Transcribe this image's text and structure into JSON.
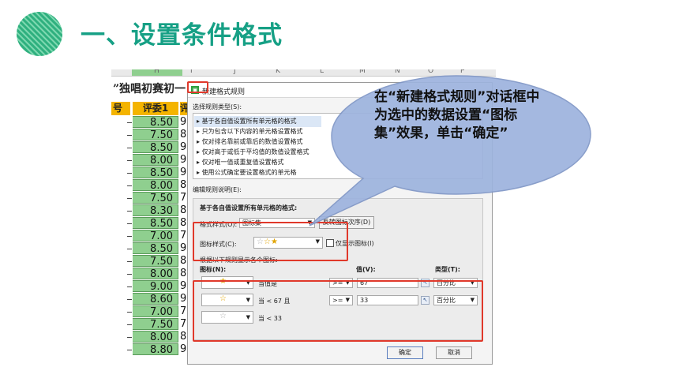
{
  "slide": {
    "title": "一、设置条件格式"
  },
  "sheet": {
    "col_headers": [
      "H",
      "I",
      "J",
      "K",
      "L",
      "M",
      "N",
      "O",
      "P"
    ],
    "title_fragment": "”独唱初赛初一",
    "header_row": {
      "left": "号",
      "score_label": "评委1",
      "next": "评"
    },
    "rows": [
      {
        "val": "8.50",
        "next": "9"
      },
      {
        "val": "7.50",
        "next": "8"
      },
      {
        "val": "8.50",
        "next": "9"
      },
      {
        "val": "8.00",
        "next": "9"
      },
      {
        "val": "8.50",
        "next": "9"
      },
      {
        "val": "8.00",
        "next": "8"
      },
      {
        "val": "7.50",
        "next": "7"
      },
      {
        "val": "8.30",
        "next": "8"
      },
      {
        "val": "8.50",
        "next": "8"
      },
      {
        "val": "7.00",
        "next": "7"
      },
      {
        "val": "8.50",
        "next": "9"
      },
      {
        "val": "7.50",
        "next": "8"
      },
      {
        "val": "8.00",
        "next": "8"
      },
      {
        "val": "9.00",
        "next": "9"
      },
      {
        "val": "8.60",
        "next": "9"
      },
      {
        "val": "7.00",
        "next": "7"
      },
      {
        "val": "7.50",
        "next": "7"
      },
      {
        "val": "8.00",
        "next": "8"
      },
      {
        "val": "8.80",
        "next": "9"
      }
    ]
  },
  "dialog": {
    "title": "新建格式规则",
    "rule_type_label": "选择规则类型(S):",
    "rule_types": [
      "基于各自值设置所有单元格的格式",
      "只为包含以下内容的单元格设置格式",
      "仅对排名靠前或靠后的数值设置格式",
      "仅对高于或低于平均值的数值设置格式",
      "仅对唯一值或重复值设置格式",
      "使用公式确定要设置格式的单元格"
    ],
    "edit_desc_label": "编辑规则说明(E):",
    "desc_heading": "基于各自值设置所有单元格的格式:",
    "format_style_label": "格式样式(O):",
    "format_style_value": "图标集",
    "reverse_button": "反转图标次序(D)",
    "icon_style_label": "图标样式(C):",
    "show_icon_only_label": "仅显示图标(I)",
    "rules_hint": "根据以下规则显示各个图标:",
    "col_icon": "图标(N):",
    "col_value": "值(V):",
    "col_type": "类型(T):",
    "icon_rules": [
      {
        "condition": "当值是",
        "op": ">=",
        "value": "67",
        "type": "百分比"
      },
      {
        "condition": "当 < 67 且",
        "op": ">=",
        "value": "33",
        "type": "百分比"
      },
      {
        "condition": "当 < 33",
        "op": "",
        "value": "",
        "type": ""
      }
    ],
    "ok_button": "确定",
    "cancel_button": "取消"
  },
  "callout": {
    "text": "在“新建格式规则”对话框中为选中的数据设置“图标集”效果，单击“确定”",
    "fill_color": "#9db3de"
  },
  "colors": {
    "title_green": "#16a085",
    "highlight_red": "#e0392b",
    "cell_green": "#8fcf8f",
    "header_yellow": "#f4b400"
  }
}
